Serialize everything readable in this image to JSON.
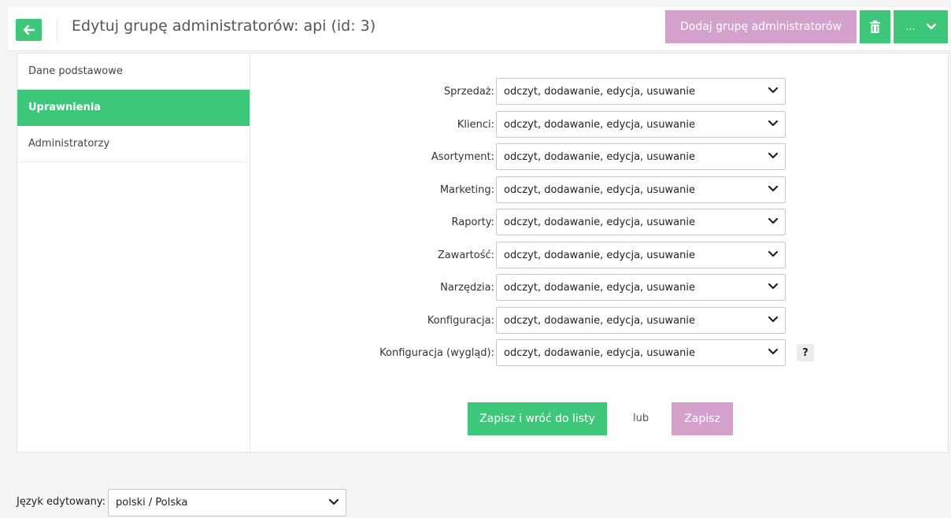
{
  "header": {
    "title": "Edytuj grupę administratorów: api (id: 3)",
    "add_group_label": "Dodaj grupę administratorów",
    "more_label": "...",
    "accent": "#3ec77b",
    "secondary": "#d4a1cc"
  },
  "sidebar": {
    "items": [
      {
        "label": "Dane podstawowe",
        "active": false
      },
      {
        "label": "Uprawnienia",
        "active": true
      },
      {
        "label": "Administratorzy",
        "active": false
      }
    ]
  },
  "permissions": [
    {
      "label": "Sprzedaż:",
      "value": "odczyt, dodawanie, edycja, usuwanie"
    },
    {
      "label": "Klienci:",
      "value": "odczyt, dodawanie, edycja, usuwanie"
    },
    {
      "label": "Asortyment:",
      "value": "odczyt, dodawanie, edycja, usuwanie"
    },
    {
      "label": "Marketing:",
      "value": "odczyt, dodawanie, edycja, usuwanie"
    },
    {
      "label": "Raporty:",
      "value": "odczyt, dodawanie, edycja, usuwanie"
    },
    {
      "label": "Zawartość:",
      "value": "odczyt, dodawanie, edycja, usuwanie"
    },
    {
      "label": "Narzędzia:",
      "value": "odczyt, dodawanie, edycja, usuwanie"
    },
    {
      "label": "Konfiguracja:",
      "value": "odczyt, dodawanie, edycja, usuwanie"
    },
    {
      "label": "Konfiguracja (wygląd):",
      "value": "odczyt, dodawanie, edycja, usuwanie",
      "help": "?"
    }
  ],
  "actions": {
    "save_return_label": "Zapisz i wróć do listy",
    "or_label": "lub",
    "save_label": "Zapisz"
  },
  "language": {
    "label": "Język edytowany:",
    "value": "polski / Polska"
  }
}
